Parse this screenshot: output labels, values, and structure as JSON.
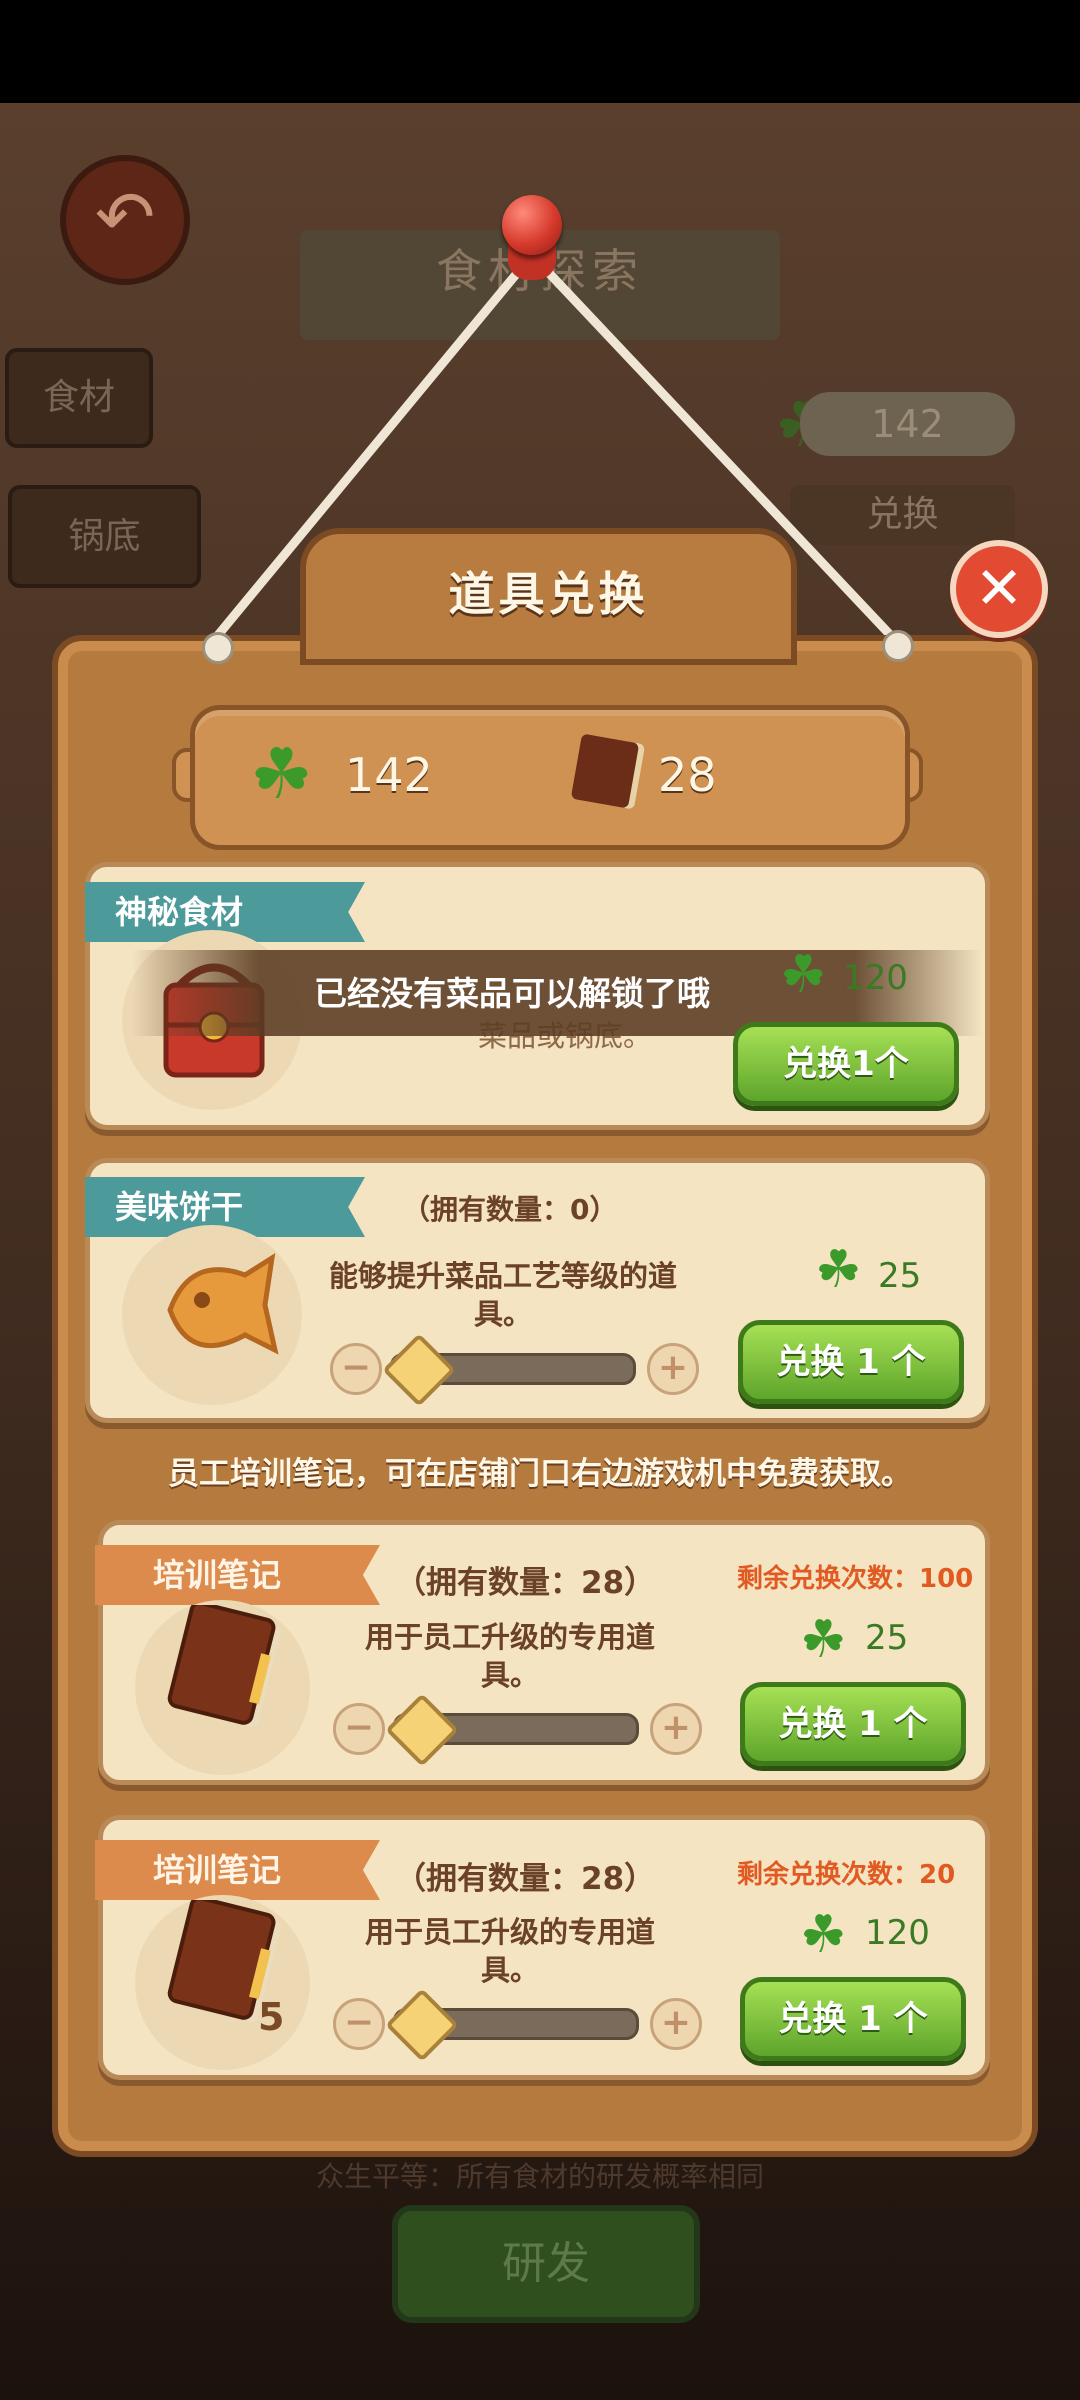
{
  "background": {
    "banner_title": "食材探索",
    "tabs": [
      "食材",
      "锅底"
    ],
    "clover_count": "142",
    "exchange_label": "兑换",
    "footer_text": "众生平等：所有食材的研发概率相同",
    "research_button": "研发"
  },
  "dialog": {
    "title": "道具兑换",
    "balance": {
      "clovers": "142",
      "notes": "28"
    },
    "toast": "已经没有菜品可以解锁了哦",
    "tip": "员工培训笔记，可在店铺门口右边游戏机中免费获取。",
    "items": [
      {
        "name": "神秘食材",
        "description": "菜品或锅底。",
        "price": "120",
        "button": "兑换1个"
      },
      {
        "name": "美味饼干",
        "owned": "（拥有数量：0）",
        "description": "能够提升菜品工艺等级的道具。",
        "price": "25",
        "button": "兑换 1 个"
      },
      {
        "name": "培训笔记",
        "owned": "（拥有数量：28）",
        "remaining": "剩余兑换次数：100",
        "description": "用于员工升级的专用道具。",
        "price": "25",
        "button": "兑换 1 个"
      },
      {
        "name": "培训笔记",
        "owned": "（拥有数量：28）",
        "remaining": "剩余兑换次数：20",
        "description": "用于员工升级的专用道具。",
        "price": "120",
        "button": "兑换 1 个",
        "bundle_count": "5"
      }
    ]
  },
  "icons": {
    "back": "back-arrow-icon",
    "close": "close-icon",
    "clover": "four-leaf-clover-icon",
    "notebook": "notebook-icon",
    "lunchbox": "mystery-box-icon",
    "cookie": "fish-cookie-icon"
  },
  "colors": {
    "board": "#b57a3e",
    "card": "#f4e4c2",
    "button_green": "#5ea52b",
    "teal_ribbon": "#4d9a9b",
    "orange_ribbon": "#dd8a4d",
    "close_red": "#e34a32"
  }
}
